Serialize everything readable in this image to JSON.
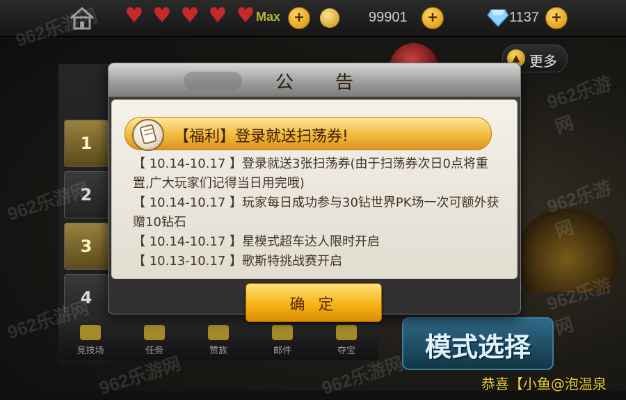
{
  "topbar": {
    "max_label": "Max",
    "coins_value": "99901",
    "diamonds_value": "1137",
    "more_label": "更多",
    "heart_count": 5
  },
  "ranks": [
    "1",
    "2",
    "3",
    "4"
  ],
  "bottom_nav": {
    "items": [
      "竞技场",
      "任务",
      "赞族",
      "邮件",
      "夺宝"
    ]
  },
  "mode_select": {
    "label": "模式选择"
  },
  "dialog": {
    "title": "公告",
    "banner_title": "【福利】登录就送扫荡券!",
    "notices": [
      "【 10.14-10.17 】登录就送3张扫荡券(由于扫荡券次日0点将重置,广大玩家们记得当日用完哦)",
      "【 10.14-10.17 】玩家每日成功参与30钻世界PK场一次可额外获赠10钻石",
      "【 10.14-10.17 】星模式超车达人限时开启",
      "【 10.13-10.17 】歌斯特挑战赛开启"
    ],
    "confirm_label": "确 定"
  },
  "watermark": "962乐游网",
  "caption": "恭喜【小鱼@泡温泉",
  "colors": {
    "accent_gold": "#f6b416",
    "banner_text": "#3a1e04",
    "notice_text": "#433326",
    "caption": "#f5d33a"
  }
}
